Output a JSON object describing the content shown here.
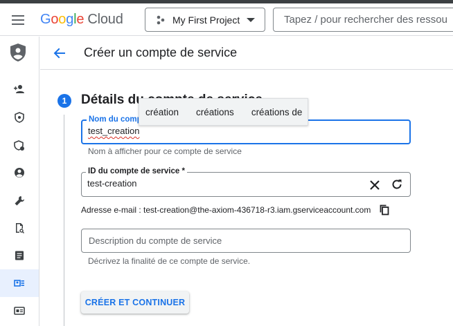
{
  "header": {
    "logo_google": [
      "G",
      "o",
      "o",
      "g",
      "l",
      "e"
    ],
    "logo_cloud": "Cloud",
    "project_name": "My First Project",
    "search_placeholder": "Tapez / pour rechercher des ressources"
  },
  "page": {
    "title": "Créer un compte de service"
  },
  "step": {
    "number": "1",
    "title": "Détails du compte de service"
  },
  "form": {
    "name_label": "Nom du compte de service",
    "name_value": "test_creation",
    "name_hint": "Nom à afficher pour ce compte de service",
    "id_label": "ID du compte de service *",
    "id_value": "test-creation",
    "email_text": "Adresse e-mail : test-creation@the-axiom-436718-r3.iam.gserviceaccount.com",
    "description_placeholder": "Description du compte de service",
    "description_hint": "Décrivez la finalité de ce compte de service.",
    "submit_label": "CRÉER ET CONTINUER"
  },
  "suggestions": [
    "création",
    "créations",
    "créations de"
  ],
  "colors": {
    "accent": "#1a73e8",
    "sidebar_active": "#e8f0fe",
    "error_underline": "#d93025"
  }
}
